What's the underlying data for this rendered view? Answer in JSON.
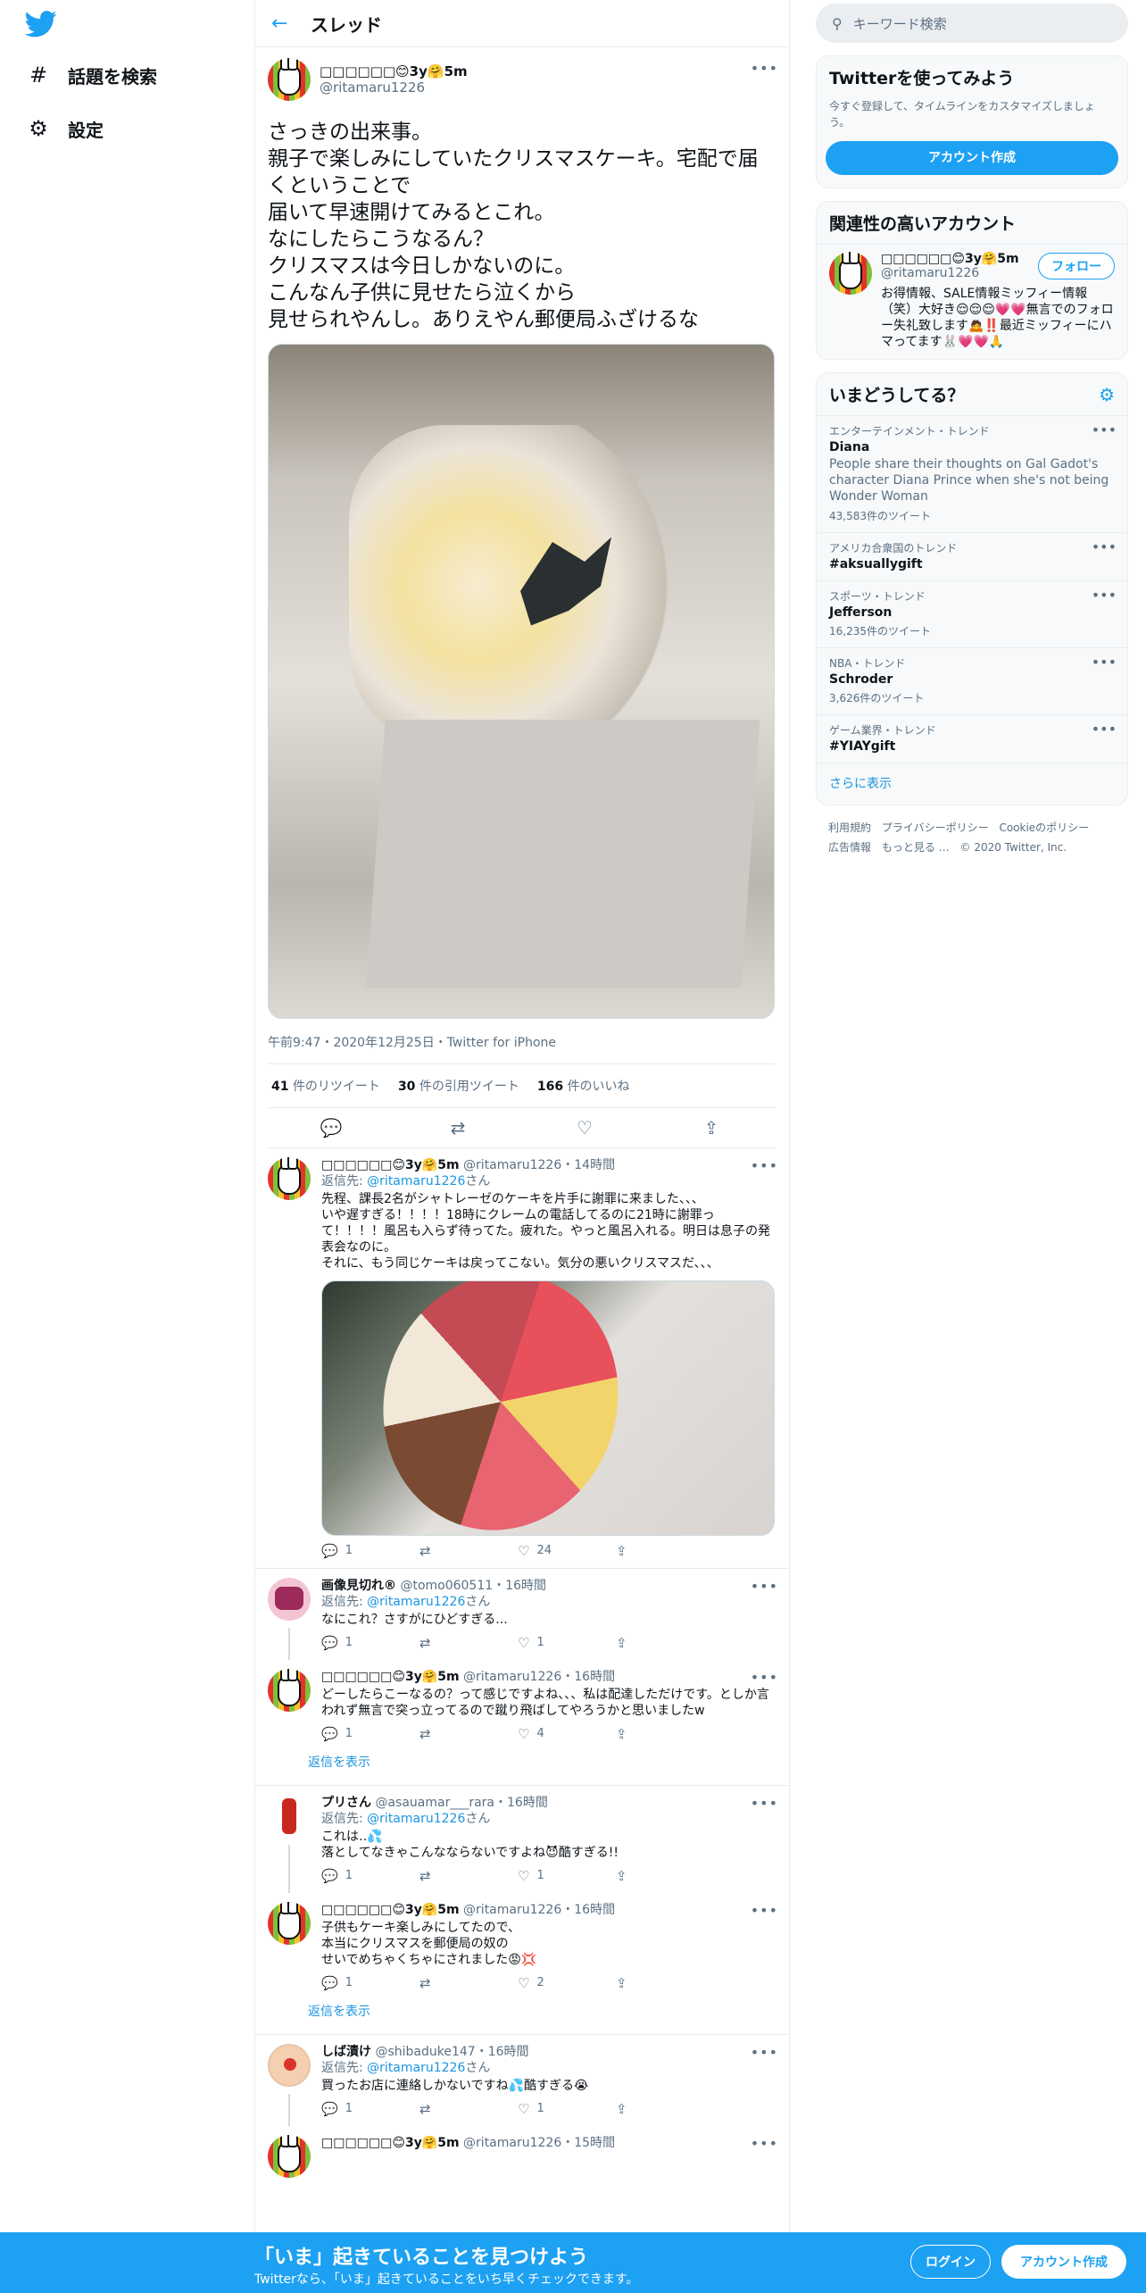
{
  "nav": {
    "logo": "twitter-bird",
    "explore_label": "話題を検索",
    "settings_label": "設定"
  },
  "header": {
    "title": "スレッド"
  },
  "main_tweet": {
    "name": "□□□□□□😊3y🤗5m",
    "handle": "@ritamaru1226",
    "text": "さっきの出来事。\n親子で楽しみにしていたクリスマスケーキ。宅配で届くということで\n届いて早速開けてみるとこれ。\nなにしたらこうなるん？\nクリスマスは今日しかないのに。\nこんなん子供に見せたら泣くから\n見せられやんし。ありえやん郵便局ふざけるな",
    "timestamp": "午前9:47・2020年12月25日・Twitter for iPhone",
    "retweets": "41",
    "retweets_label": "件のリツイート",
    "quotes": "30",
    "quotes_label": "件の引用ツイート",
    "likes": "166",
    "likes_label": "件のいいね"
  },
  "replies": [
    {
      "name": "□□□□□□😊3y🤗5m",
      "handle": "@ritamaru1226",
      "time": "・14時間",
      "reply_to_prefix": "返信先: ",
      "reply_to": "@ritamaru1226",
      "reply_to_suffix": "さん",
      "text": "先程、課長2名がシャトレーゼのケーキを片手に謝罪に来ました、、、\nいや遅すぎる！！！！18時にクレームの電話してるのに21時に謝罪って！！！！風呂も入らず待ってた。疲れた。やっと風呂入れる。明日は息子の発表会なのに。\nそれに、もう同じケーキは戻ってこない。気分の悪いクリスマスだ、、、",
      "replies": "1",
      "retweets": "",
      "likes": "24"
    },
    {
      "name": "画像見切れ®",
      "handle": "@tomo060511",
      "time": "・16時間",
      "reply_to_prefix": "返信先: ",
      "reply_to": "@ritamaru1226",
      "reply_to_suffix": "さん",
      "text": "なにこれ？さすがにひどすぎる...",
      "replies": "1",
      "retweets": "",
      "likes": "1"
    },
    {
      "name": "□□□□□□😊3y🤗5m",
      "handle": "@ritamaru1226",
      "time": "・16時間",
      "text": "どーしたらこーなるの？って感じですよね、、、私は配達しただけです。としか言われず無言で突っ立ってるので蹴り飛ばしてやろうかと思いましたw",
      "replies": "1",
      "retweets": "",
      "likes": "4"
    },
    {
      "name": "プリさん",
      "handle": "@asauamar___rara",
      "time": "・16時間",
      "reply_to_prefix": "返信先: ",
      "reply_to": "@ritamaru1226",
      "reply_to_suffix": "さん",
      "text": "これは‥💦\n落としてなきゃこんなならないですよね😈酷すぎる!!",
      "replies": "1",
      "retweets": "",
      "likes": "1"
    },
    {
      "name": "□□□□□□😊3y🤗5m",
      "handle": "@ritamaru1226",
      "time": "・16時間",
      "text": "子供もケーキ楽しみにしてたので、\n本当にクリスマスを郵便局の奴の\nせいでめちゃくちゃにされました😡💢",
      "replies": "1",
      "retweets": "",
      "likes": "2"
    },
    {
      "name": "しば漬け",
      "handle": "@shibaduke147",
      "time": "・16時間",
      "reply_to_prefix": "返信先: ",
      "reply_to": "@ritamaru1226",
      "reply_to_suffix": "さん",
      "text": "買ったお店に連絡しかないですね💦酷すぎる😭",
      "replies": "1",
      "retweets": "",
      "likes": "1"
    },
    {
      "name": "□□□□□□😊3y🤗5m",
      "handle": "@ritamaru1226",
      "time": "・15時間"
    }
  ],
  "show_replies_label": "返信を表示",
  "right": {
    "search_placeholder": "キーワード検索",
    "signup_card": {
      "title": "Twitterを使ってみよう",
      "subtitle": "今すぐ登録して、タイムラインをカスタマイズしましょう。",
      "button": "アカウント作成"
    },
    "relevant": {
      "title": "関連性の高いアカウント",
      "name": "□□□□□□😊3y🤗5m",
      "handle": "@ritamaru1226",
      "follow": "フォロー",
      "bio": "お得情報、SALE情報ミッフィー情報（笑）大好き😌😌😌💗💗無言でのフォロー失礼致します🙇‼️最近ミッフィーにハマってます🐰💗💗🙏"
    },
    "trends_title": "いまどうしてる？",
    "trends": [
      {
        "category": "エンターテインメント・トレンド",
        "name": "Diana",
        "desc": "People share their thoughts on Gal Gadot's character Diana Prince when she's not being Wonder Woman",
        "count": "43,583件のツイート"
      },
      {
        "category": "アメリカ合衆国のトレンド",
        "name": "#aksuallygift",
        "desc": "",
        "count": ""
      },
      {
        "category": "スポーツ・トレンド",
        "name": "Jefferson",
        "desc": "",
        "count": "16,235件のツイート"
      },
      {
        "category": "NBA・トレンド",
        "name": "Schroder",
        "desc": "",
        "count": "3,626件のツイート"
      },
      {
        "category": "ゲーム業界・トレンド",
        "name": "#YIAYgift",
        "desc": "",
        "count": ""
      }
    ],
    "show_more": "さらに表示",
    "footer": [
      "利用規約",
      "プライバシーポリシー",
      "Cookieのポリシー",
      "広告情報",
      "もっと見る …",
      "© 2020 Twitter, Inc."
    ]
  },
  "bottom_bar": {
    "title": "「いま」起きていることを見つけよう",
    "subtitle": "Twitterなら、「いま」起きていることをいち早くチェックできます。",
    "login": "ログイン",
    "signup": "アカウント作成"
  },
  "colors": {
    "accent": "#1da1f2",
    "link": "#1b95e0",
    "muted": "#5b7083",
    "border": "#e6ecf0"
  }
}
